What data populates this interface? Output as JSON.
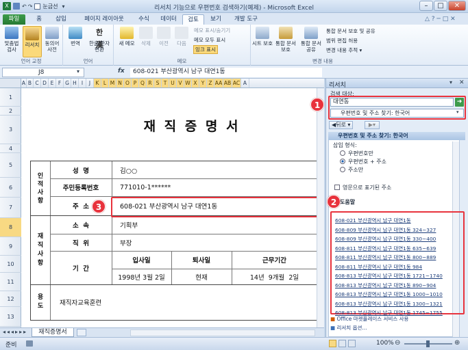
{
  "window": {
    "title": "리서치 기능으로 우편번호 검색하기(예제) - Microsoft Excel",
    "qat_label": "눈금선"
  },
  "ribbon": {
    "tabs": [
      "파일",
      "홈",
      "삽입",
      "페이지 레이아웃",
      "수식",
      "데이터",
      "검토",
      "보기",
      "개발 도구"
    ],
    "active_tab": "검토",
    "groups": {
      "proofing": {
        "label": "언어 교정",
        "buttons": [
          "맞춤법 검사",
          "리서치",
          "동의어 사전"
        ]
      },
      "language": {
        "label": "언어",
        "buttons": [
          "번역",
          "한글/한자 변환"
        ]
      },
      "comments": {
        "label": "메모",
        "buttons": [
          "새 메모",
          "삭제",
          "이전",
          "다음"
        ],
        "small": [
          "메모 표시/숨기기",
          "메모 모두 표시",
          "잉크 표시"
        ]
      },
      "changes": {
        "label": "변경 내용",
        "buttons": [
          "시트 보호",
          "통합 문서 보호",
          "통합 문서 공유"
        ],
        "small": [
          "통합 문서 보호 및 공유",
          "범위 편집 허용",
          "변경 내용 추적 ▾"
        ]
      }
    }
  },
  "formula_bar": {
    "cell_ref": "J8",
    "fx": "fx",
    "value": "608-021 부산광역시 남구 대연1동"
  },
  "sheet": {
    "columns": [
      "A",
      "B",
      "C",
      "D",
      "E",
      "F",
      "G",
      "H",
      "I",
      "J",
      "K",
      "L",
      "M",
      "N",
      "O",
      "P",
      "Q",
      "R",
      "S",
      "T",
      "U",
      "V",
      "W",
      "X",
      "Y",
      "Z",
      "AA",
      "AB",
      "AC",
      "A"
    ],
    "rows": [
      "1",
      "2",
      "3",
      "4",
      "5",
      "6",
      "7",
      "8",
      "9",
      "10",
      "11",
      "12",
      "13",
      "14",
      "15"
    ],
    "selected_row": "8"
  },
  "form": {
    "title": "재 직 증 명 서",
    "sec1": "인\n적\n사\n항",
    "sec2": "재\n직\n사\n항",
    "sec3": "용\n도",
    "name_label": "성  명",
    "name_value": "김○○",
    "id_label": "주민등록번호",
    "id_value": "771010-1******",
    "addr_label": "주  소",
    "addr_value": "608-021 부산광역시 남구 대연1동",
    "dept_label": "소  속",
    "dept_value": "기획부",
    "pos_label": "직  위",
    "pos_value": "부장",
    "period_label": "기  간",
    "join_label": "입사일",
    "leave_label": "퇴사일",
    "tenure_label": "근무기간",
    "join_value": "1998년 3월 2일",
    "leave_value": "현재",
    "tenure_value": "14년  9개월  2일",
    "purpose_value": "재직자교육훈련"
  },
  "sheet_tab": "재직증명서",
  "status": {
    "ready": "준비",
    "zoom": "100%"
  },
  "research": {
    "title": "리서치",
    "search_label": "검색 대상:",
    "query": "대연동",
    "source": "우편번호 및 주소 찾기: 한국어",
    "back_label": "뒤로",
    "section_title": "우편번호 및 주소 찾기: 한국어",
    "insert_label": "삽입 형식:",
    "options": [
      "우편번호만",
      "우편번호 + 주소",
      "주소만"
    ],
    "selected_option": 1,
    "english_label": "영문으로 표기된 주소",
    "help_label": "도움말",
    "results": [
      "608-021 부산광역시 남구 대연1동",
      "608-809 부산광역시 남구 대연1동 324~327",
      "608-809 부산광역시 남구 대연1동 330~400",
      "608-811 부산광역시 남구 대연1동 635~639",
      "608-811 부산광역시 남구 대연1동 800~889",
      "608-811 부산광역시 남구 대연1동 984",
      "608-813 부산광역시 남구 대연1동 1721~1740",
      "608-813 부산광역시 남구 대연1동 890~904",
      "608-813 부산광역시 남구 대연1동 1000~1010",
      "608-813 부산광역시 남구 대연1동 1300~1321",
      "608-813 부산광역시 남구 대연1동 1745~1755"
    ],
    "footer": [
      "Office 마켓플레이스 서비스 사용",
      "리서치 옵션..."
    ]
  },
  "badges": [
    "1",
    "2",
    "3"
  ]
}
